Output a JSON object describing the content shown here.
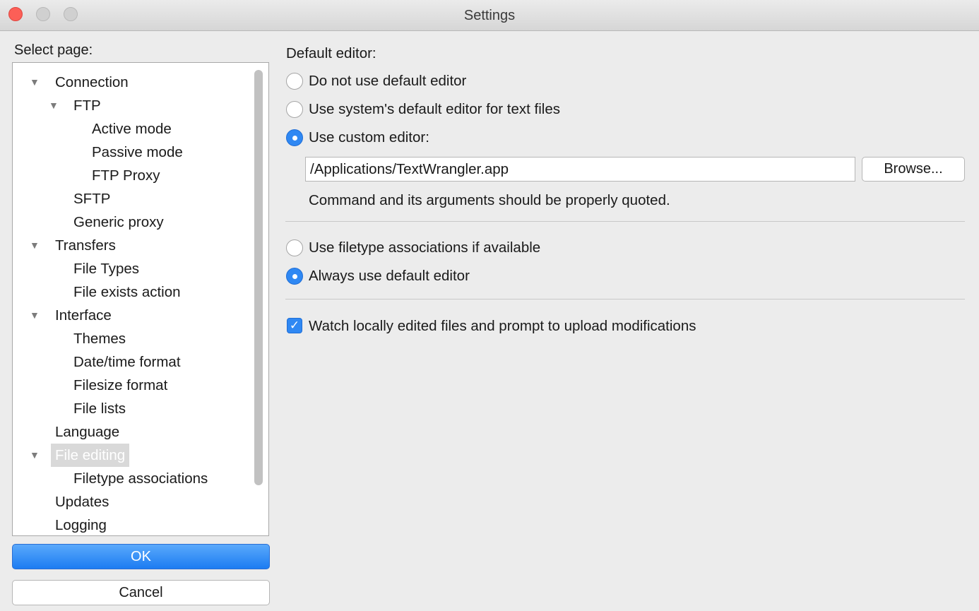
{
  "window": {
    "title": "Settings"
  },
  "sidebar": {
    "label": "Select page:",
    "items": [
      {
        "label": "Connection",
        "expanded": true
      },
      {
        "label": "FTP",
        "expanded": true
      },
      {
        "label": "Active mode"
      },
      {
        "label": "Passive mode"
      },
      {
        "label": "FTP Proxy"
      },
      {
        "label": "SFTP"
      },
      {
        "label": "Generic proxy"
      },
      {
        "label": "Transfers",
        "expanded": true
      },
      {
        "label": "File Types"
      },
      {
        "label": "File exists action"
      },
      {
        "label": "Interface",
        "expanded": true
      },
      {
        "label": "Themes"
      },
      {
        "label": "Date/time format"
      },
      {
        "label": "Filesize format"
      },
      {
        "label": "File lists"
      },
      {
        "label": "Language"
      },
      {
        "label": "File editing",
        "expanded": true,
        "selected": true
      },
      {
        "label": "Filetype associations"
      },
      {
        "label": "Updates"
      },
      {
        "label": "Logging"
      }
    ]
  },
  "buttons": {
    "ok": "OK",
    "cancel": "Cancel",
    "browse": "Browse..."
  },
  "editor": {
    "heading": "Default editor:",
    "options": [
      {
        "label": "Do not use default editor",
        "selected": false
      },
      {
        "label": "Use system's default editor for text files",
        "selected": false
      },
      {
        "label": "Use custom editor:",
        "selected": true
      }
    ],
    "custom_path": "/Applications/TextWrangler.app",
    "hint": "Command and its arguments should be properly quoted."
  },
  "association": {
    "options": [
      {
        "label": "Use filetype associations if available",
        "selected": false
      },
      {
        "label": "Always use default editor",
        "selected": true
      }
    ]
  },
  "watch": {
    "label": "Watch locally edited files and prompt to upload modifications",
    "checked": true
  },
  "colors": {
    "accent": "#2f88f3",
    "close": "#fc5f57"
  }
}
